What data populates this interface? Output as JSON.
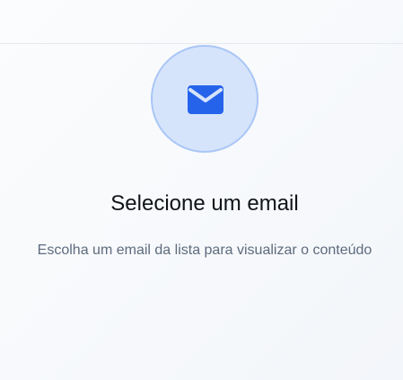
{
  "empty_state": {
    "icon": "mail-icon",
    "title": "Selecione um email",
    "subtitle": "Escolha um email da lista para visualizar o conteúdo"
  },
  "colors": {
    "accent": "#2563eb",
    "icon_circle_bg": "#d6e4fb",
    "icon_circle_border": "#a9c6f6",
    "title": "#101418",
    "subtitle": "#5e6b7d"
  }
}
